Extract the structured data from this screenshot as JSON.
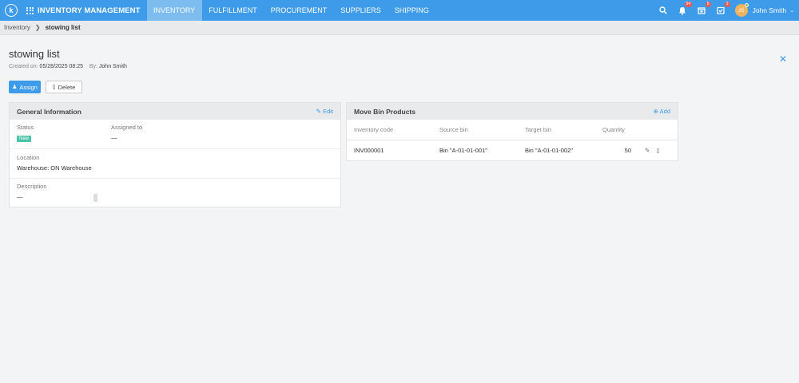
{
  "app": {
    "logo_letter": "k",
    "name": "INVENTORY MANAGEMENT"
  },
  "nav": [
    {
      "label": "INVENTORY",
      "active": true
    },
    {
      "label": "FULFILLMENT",
      "active": false
    },
    {
      "label": "PROCUREMENT",
      "active": false
    },
    {
      "label": "SUPPLIERS",
      "active": false
    },
    {
      "label": "SHIPPING",
      "active": false
    }
  ],
  "tools": {
    "notifications_badge": "54",
    "calendar_badge": "5",
    "tasks_badge": "3"
  },
  "user": {
    "initials": "JS",
    "name": "John Smith"
  },
  "breadcrumb": {
    "parent": "Inventory",
    "current": "stowing list"
  },
  "page": {
    "title": "stowing list",
    "created_label": "Created on:",
    "created_value": "05/28/2025 08:25",
    "by_label": "By:",
    "by_value": "John Smith"
  },
  "actions": {
    "assign": "Assign",
    "delete": "Delete"
  },
  "general": {
    "title": "General Information",
    "edit": "Edit",
    "status_label": "Status",
    "status_value": "New",
    "assigned_label": "Assigned to",
    "assigned_value": "—",
    "location_label": "Location",
    "location_value": "Warehouse: ON Warehouse",
    "description_label": "Description",
    "description_value": "—"
  },
  "move_bin": {
    "title": "Move Bin Products",
    "add": "Add",
    "columns": [
      "Inventory code",
      "Source bin",
      "Target bin",
      "Quantity"
    ],
    "rows": [
      {
        "code": "INV000001",
        "source": "Bin \"A-01-01-001\"",
        "target": "Bin \"A-01-01-002\"",
        "qty": "50"
      }
    ]
  },
  "colors": {
    "primary": "#3d9be9",
    "nav_active": "#7cbcef",
    "status_new": "#4cc3a9",
    "badge": "#ee5a4f"
  }
}
